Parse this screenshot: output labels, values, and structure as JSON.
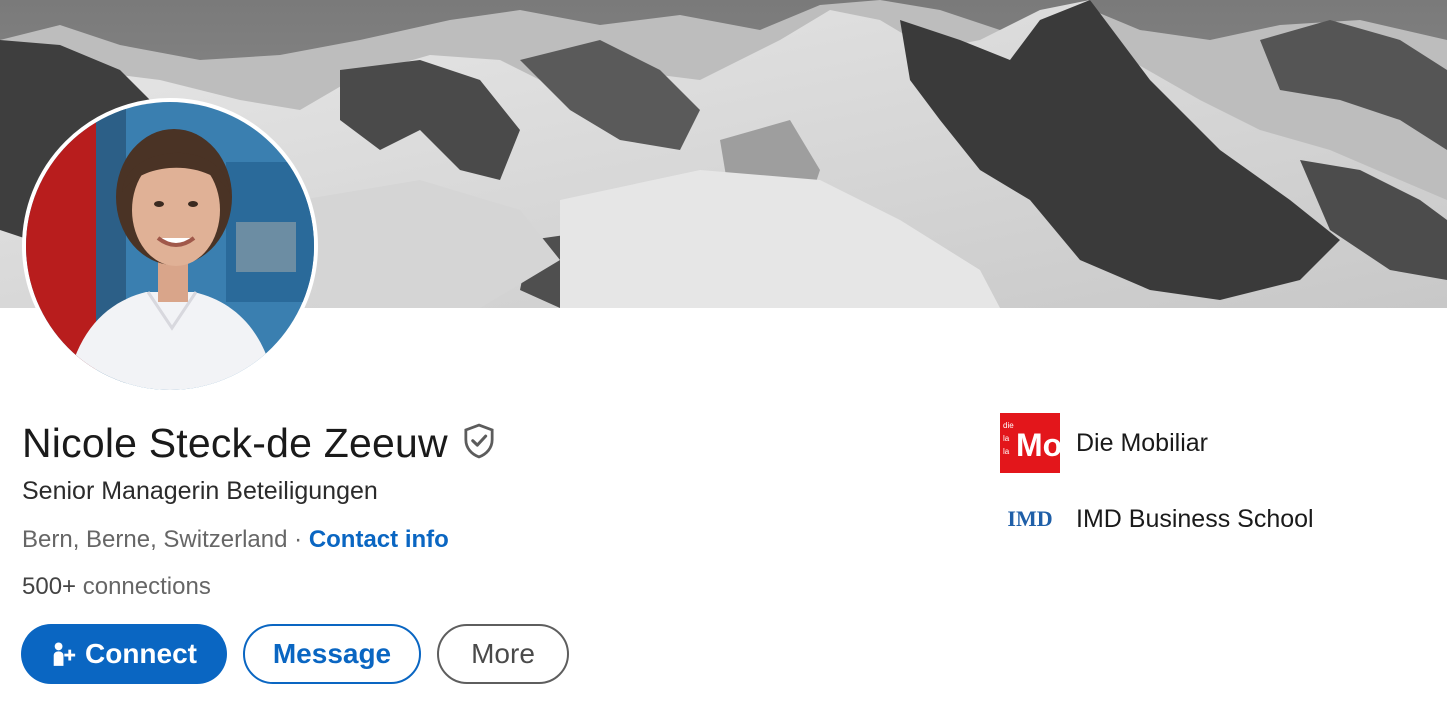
{
  "profile": {
    "name": "Nicole Steck-de Zeeuw",
    "headline": "Senior Managerin Beteiligungen",
    "location": "Bern, Berne, Switzerland",
    "separator": "·",
    "contact_info_label": "Contact info",
    "connections_count": "500+",
    "connections_label": "connections"
  },
  "actions": {
    "connect_label": "Connect",
    "message_label": "Message",
    "more_label": "More"
  },
  "organizations": [
    {
      "name": "Die Mobiliar",
      "logo_text": "Mo",
      "logo_small": "die\nla\nla"
    },
    {
      "name": "IMD Business School",
      "logo_text": "IMD"
    }
  ],
  "icons": {
    "verified": "shield-check-icon",
    "connect": "add-person-icon"
  },
  "colors": {
    "primary": "#0a66c2",
    "mobiliar_red": "#e3161b",
    "imd_blue": "#1f5fa8"
  }
}
